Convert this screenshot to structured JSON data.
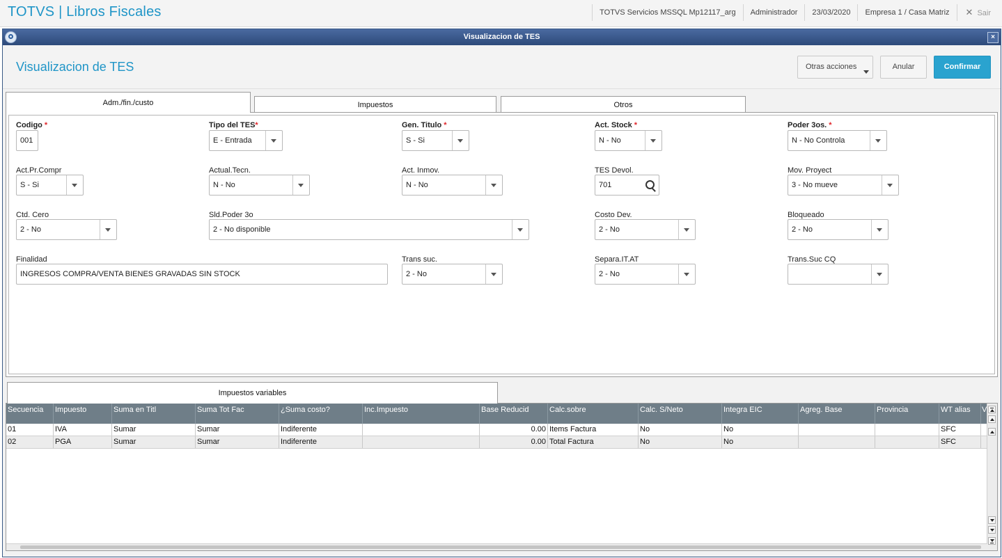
{
  "app": {
    "title": "TOTVS | Libros Fiscales",
    "server": "TOTVS Servicios MSSQL Mp12117_arg",
    "user": "Administrador",
    "date": "23/03/2020",
    "company": "Empresa 1 / Casa Matriz",
    "exit_label": "Sair",
    "exit_icon": "close-icon"
  },
  "dialog": {
    "title": "Visualizacion de TES",
    "close_glyph": "×",
    "page_title": "Visualizacion de TES",
    "buttons": {
      "more": "Otras acciones",
      "cancel": "Anular",
      "confirm": "Confirmar"
    }
  },
  "tabs": [
    {
      "label": "Adm./fin./custo",
      "active": true
    },
    {
      "label": "Impuestos",
      "active": false
    },
    {
      "label": "Otros",
      "active": false
    }
  ],
  "fields": {
    "codigo": {
      "label": "Codigo",
      "value": "001",
      "required": "*"
    },
    "tipo_tes": {
      "label": "Tipo del TES",
      "value": "E - Entrada",
      "required": "*"
    },
    "gen_titulo": {
      "label": "Gen. Titulo",
      "value": "S - Si",
      "required": "*"
    },
    "act_stock": {
      "label": "Act. Stock",
      "value": "N - No",
      "required": "*"
    },
    "poder_3os": {
      "label": "Poder 3os.",
      "value": "N - No Controla",
      "required": "*"
    },
    "act_pr_compr": {
      "label": "Act.Pr.Compr",
      "value": "S - Si"
    },
    "actual_tecn": {
      "label": "Actual.Tecn.",
      "value": "N - No"
    },
    "act_inmov": {
      "label": "Act. Inmov.",
      "value": "N - No"
    },
    "tes_devol": {
      "label": "TES Devol.",
      "value": "701"
    },
    "mov_proyect": {
      "label": "Mov. Proyect",
      "value": "3 - No mueve"
    },
    "ctd_cero": {
      "label": "Ctd. Cero",
      "value": "2 - No"
    },
    "sld_poder": {
      "label": "Sld.Poder 3o",
      "value": "2 - No disponible"
    },
    "costo_dev": {
      "label": "Costo Dev.",
      "value": "2 - No"
    },
    "bloqueado": {
      "label": "Bloqueado",
      "value": "2 - No"
    },
    "finalidad": {
      "label": "Finalidad",
      "value": "INGRESOS COMPRA/VENTA BIENES GRAVADAS SIN STOCK"
    },
    "trans_suc": {
      "label": "Trans suc.",
      "value": "2 - No"
    },
    "separa_itat": {
      "label": "Separa.IT.AT",
      "value": "2 - No"
    },
    "trans_suc_cq": {
      "label": "Trans.Suc CQ",
      "value": ""
    }
  },
  "grid": {
    "tab_label": "Impuestos variables",
    "columns": [
      "Secuencia",
      "Impuesto",
      "Suma en Titl",
      "Suma Tot Fac",
      "¿Suma costo?",
      "Inc.Impuesto",
      "Base Reducid",
      "Calc.sobre",
      "Calc. S/Neto",
      "Integra EIC",
      "Agreg. Base",
      "Provincia",
      "WT alias",
      "V"
    ],
    "rows": [
      [
        "01",
        "IVA",
        "Sumar",
        "Sumar",
        "Indiferente",
        "",
        "0.00",
        "Items Factura",
        "No",
        "No",
        "",
        "",
        "SFC",
        ""
      ],
      [
        "02",
        "PGA",
        "Sumar",
        "Sumar",
        "Indiferente",
        "",
        "0.00",
        "Total Factura",
        "No",
        "No",
        "",
        "",
        "SFC",
        ""
      ]
    ]
  }
}
